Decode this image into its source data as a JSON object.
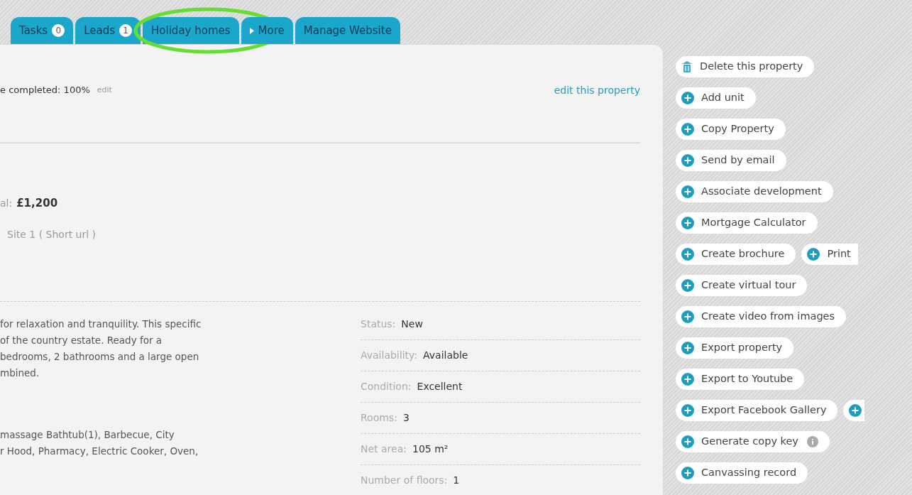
{
  "tabs": [
    {
      "label": "Tasks",
      "count": "0",
      "kind": "plain",
      "selected": false
    },
    {
      "label": "Leads",
      "count": "1",
      "kind": "plain",
      "selected": false
    },
    {
      "label": "Holiday homes",
      "kind": "plain",
      "selected": false,
      "highlighted": true
    },
    {
      "label": "More",
      "kind": "dropdown",
      "selected": false
    },
    {
      "label": "Manage Website",
      "kind": "plain",
      "selected": false
    }
  ],
  "header": {
    "completion": "e completed: 100%",
    "completion_edit": "edit",
    "edit_link": "edit this property"
  },
  "price": {
    "label": "al:",
    "value": "£1,200"
  },
  "site": "Site 1 ( Short url )",
  "description": [
    "for relaxation and tranquility. This specific",
    "of the country estate. Ready for a",
    "bedrooms, 2 bathrooms and a large open",
    "mbined."
  ],
  "features": [
    "massage Bathtub(1), Barbecue, City",
    "r Hood, Pharmacy, Electric Cooker, Oven,"
  ],
  "details": [
    {
      "label": "Status:",
      "value": "New"
    },
    {
      "label": "Availability:",
      "value": "Available"
    },
    {
      "label": "Condition:",
      "value": "Excellent"
    },
    {
      "label": "Rooms:",
      "value": "3"
    },
    {
      "label": "Net area:",
      "value": "105 m²"
    },
    {
      "label": "Number of floors:",
      "value": "1"
    }
  ],
  "actions": [
    {
      "label": "Delete this property",
      "kind": "delete"
    },
    {
      "label": "Add unit",
      "kind": "add"
    },
    {
      "label": "Copy Property",
      "kind": "add"
    },
    {
      "label": "Send by email",
      "kind": "add"
    },
    {
      "label": "Associate development",
      "kind": "add"
    },
    {
      "label": "Mortgage Calculator",
      "kind": "add"
    },
    {
      "label": "Create brochure",
      "kind": "add",
      "extra": {
        "kind": "labelled",
        "label": "Print"
      }
    },
    {
      "label": "Create virtual tour",
      "kind": "add"
    },
    {
      "label": "Create video from images",
      "kind": "add"
    },
    {
      "label": "Export property",
      "kind": "add"
    },
    {
      "label": "Export to Youtube",
      "kind": "add"
    },
    {
      "label": "Export Facebook Gallery",
      "kind": "add",
      "extra": {
        "kind": "icon"
      }
    },
    {
      "label": "Generate copy key",
      "kind": "add",
      "info": true
    },
    {
      "label": "Canvassing record",
      "kind": "add"
    }
  ]
}
